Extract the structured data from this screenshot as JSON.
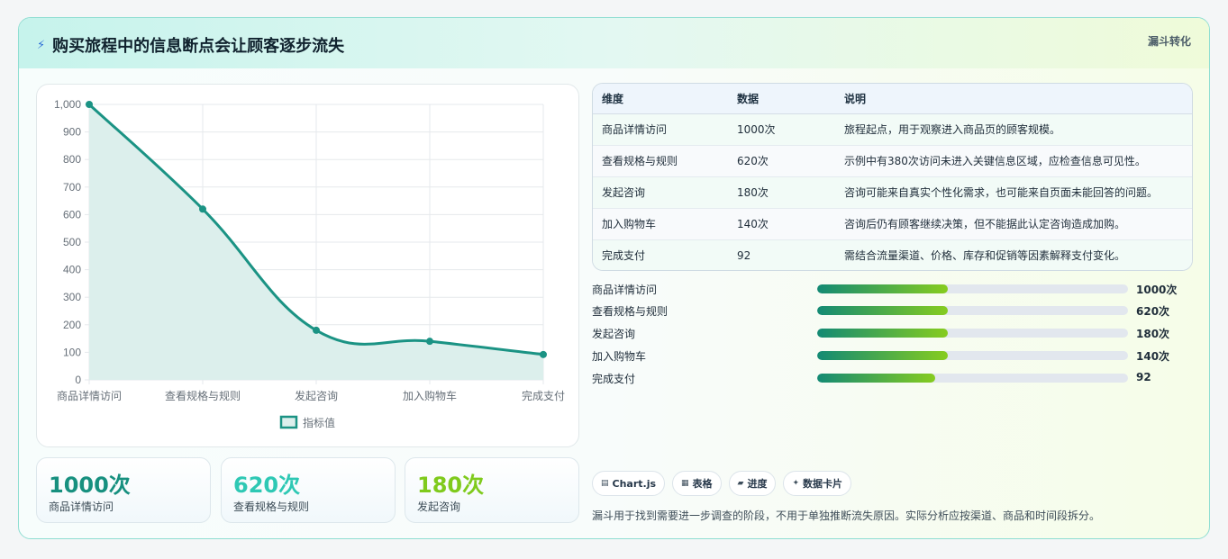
{
  "header": {
    "title": "购买旅程中的信息断点会让顾客逐步流失",
    "tag": "漏斗转化"
  },
  "icons": {
    "title_icon": "lightning-icon"
  },
  "chart_data": {
    "type": "line",
    "categories": [
      "商品详情访问",
      "查看规格与规则",
      "发起咨询",
      "加入购物车",
      "完成支付"
    ],
    "values": [
      1000,
      620,
      180,
      140,
      92
    ],
    "ylim": [
      0,
      1000
    ],
    "yticks": [
      0,
      100,
      200,
      300,
      400,
      500,
      600,
      700,
      800,
      900,
      1000
    ],
    "ytick_labels": [
      "0",
      "100",
      "200",
      "300",
      "400",
      "500",
      "600",
      "700",
      "800",
      "900",
      "1,000"
    ],
    "legend": {
      "label": "指标值",
      "placement": "bottom"
    },
    "area_fill": true,
    "grid": true,
    "colors": {
      "line": "#1b9384",
      "fill": "#dcefec"
    }
  },
  "stats": [
    {
      "value": "1000次",
      "label": "商品详情访问",
      "color": "#17907f"
    },
    {
      "value": "620次",
      "label": "查看规格与规则",
      "color": "#2ec8b4"
    },
    {
      "value": "180次",
      "label": "发起咨询",
      "color": "#7fca1c"
    }
  ],
  "table": {
    "headers": [
      "维度",
      "数据",
      "说明"
    ],
    "rows": [
      [
        "商品详情访问",
        "1000次",
        "旅程起点，用于观察进入商品页的顾客规模。"
      ],
      [
        "查看规格与规则",
        "620次",
        "示例中有380次访问未进入关键信息区域，应检查信息可见性。"
      ],
      [
        "发起咨询",
        "180次",
        "咨询可能来自真实个性化需求，也可能来自页面未能回答的问题。"
      ],
      [
        "加入购物车",
        "140次",
        "咨询后仍有顾客继续决策，但不能据此认定咨询造成加购。"
      ],
      [
        "完成支付",
        "92",
        "需结合流量渠道、价格、库存和促销等因素解释支付变化。"
      ]
    ]
  },
  "progress": [
    {
      "label": "商品详情访问",
      "value": "1000次",
      "fraction": 0.42
    },
    {
      "label": "查看规格与规则",
      "value": "620次",
      "fraction": 0.42
    },
    {
      "label": "发起咨询",
      "value": "180次",
      "fraction": 0.42
    },
    {
      "label": "加入购物车",
      "value": "140次",
      "fraction": 0.42
    },
    {
      "label": "完成支付",
      "value": "92",
      "fraction": 0.38
    }
  ],
  "chips": [
    {
      "icon": "▤",
      "label": "Chart.js"
    },
    {
      "icon": "▦",
      "label": "表格"
    },
    {
      "icon": "▰",
      "label": "进度"
    },
    {
      "icon": "✦",
      "label": "数据卡片"
    }
  ],
  "note": "漏斗用于找到需要进一步调查的阶段，不用于单独推断流失原因。实际分析应按渠道、商品和时间段拆分。"
}
